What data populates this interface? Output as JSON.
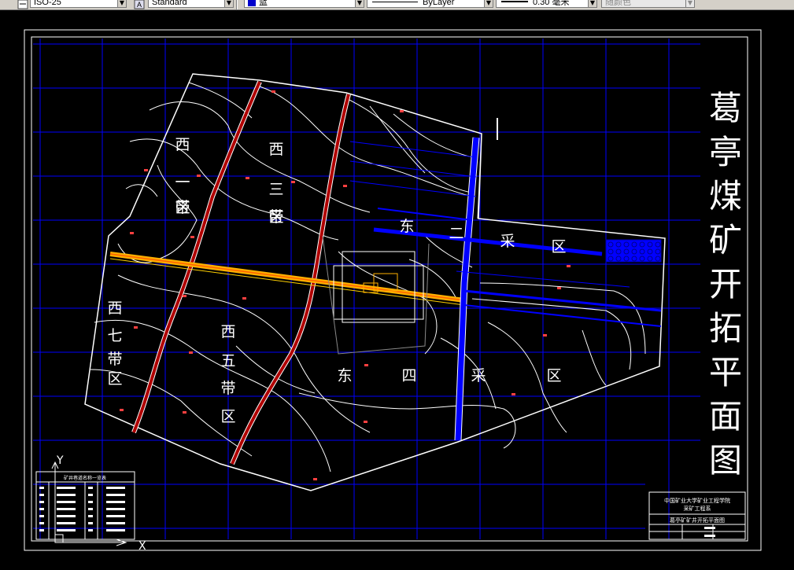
{
  "toolbar": {
    "dimstyle_value": "ISO-25",
    "textstyle_value": "Standard",
    "color_value": "蓝",
    "linetype_value": "ByLayer",
    "lineweight_value": "0.30 毫米",
    "plotstyle_value": "随颜色"
  },
  "drawing": {
    "title": "葛亭煤矿开拓平面图",
    "region_labels": [
      {
        "text": "西一带区",
        "id": "west-1"
      },
      {
        "text": "西三带区",
        "id": "west-3"
      },
      {
        "text": "西五带区",
        "id": "west-5"
      },
      {
        "text": "西七带区",
        "id": "west-7"
      },
      {
        "text": "东二采区",
        "id": "east-2"
      },
      {
        "text": "东四采区",
        "id": "east-4"
      }
    ],
    "ucs": {
      "x_label": "X",
      "y_label": "Y"
    },
    "legend_table": {
      "title": "矿井巷道名称一览表"
    },
    "title_block": {
      "line1": "中国矿业大学矿业工程学院",
      "line2": "采矿工程系",
      "drawing_name": "葛亭矿矿井开拓平面图"
    }
  },
  "colors": {
    "background": "#000000",
    "grid": "#0000ff",
    "contour": "#ffffff",
    "fault": "#c00000",
    "main_road": "#ffb000",
    "east_roadway": "#0000ff"
  }
}
